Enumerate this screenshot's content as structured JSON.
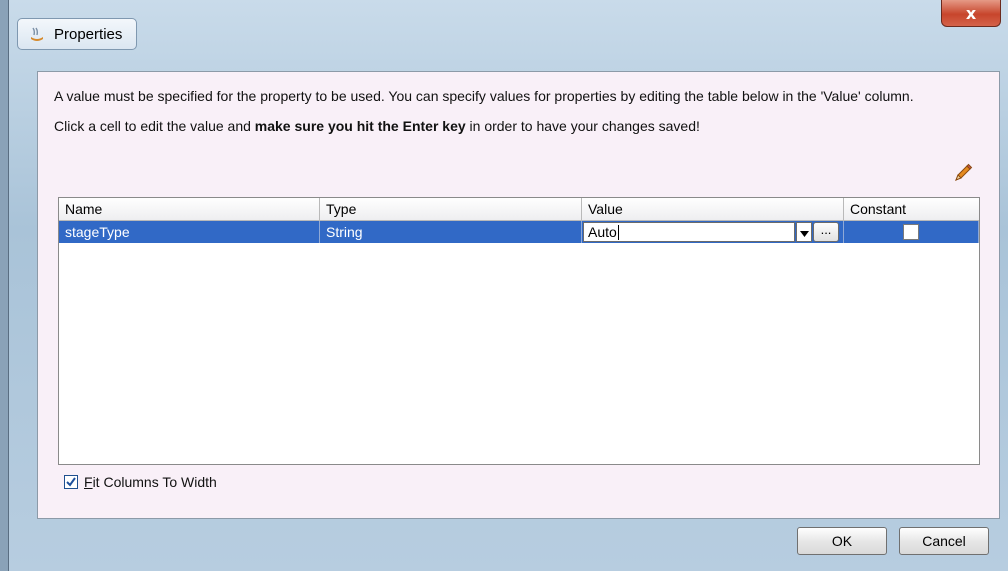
{
  "window": {
    "title": "Properties",
    "close_symbol": "x"
  },
  "info": {
    "line1": "A value must be specified for the property to be used. You can specify values for properties by editing the table below in the 'Value' column.",
    "line2_before": "Click a cell to edit the value and ",
    "line2_bold": "make sure you hit the Enter key",
    "line2_after": " in order to have your changes saved!"
  },
  "table": {
    "headers": [
      "Name",
      "Type",
      "Value",
      "Constant"
    ],
    "rows": [
      {
        "name": "stageType",
        "type": "String",
        "value": "Auto",
        "constant": false
      }
    ],
    "ellipsis_label": "..."
  },
  "fit_columns": {
    "checked": true,
    "label_first": "F",
    "label_rest": "it Columns To Width"
  },
  "buttons": {
    "ok": "OK",
    "cancel": "Cancel"
  },
  "icons": {
    "title": "properties-app-icon",
    "edit": "pencil-icon",
    "dropdown": "triangle-down-icon",
    "check": "checkmark-icon"
  },
  "colors": {
    "selection": "#3169c6",
    "panel_bg": "#f9f0f8",
    "close_red": "#c7452c"
  }
}
